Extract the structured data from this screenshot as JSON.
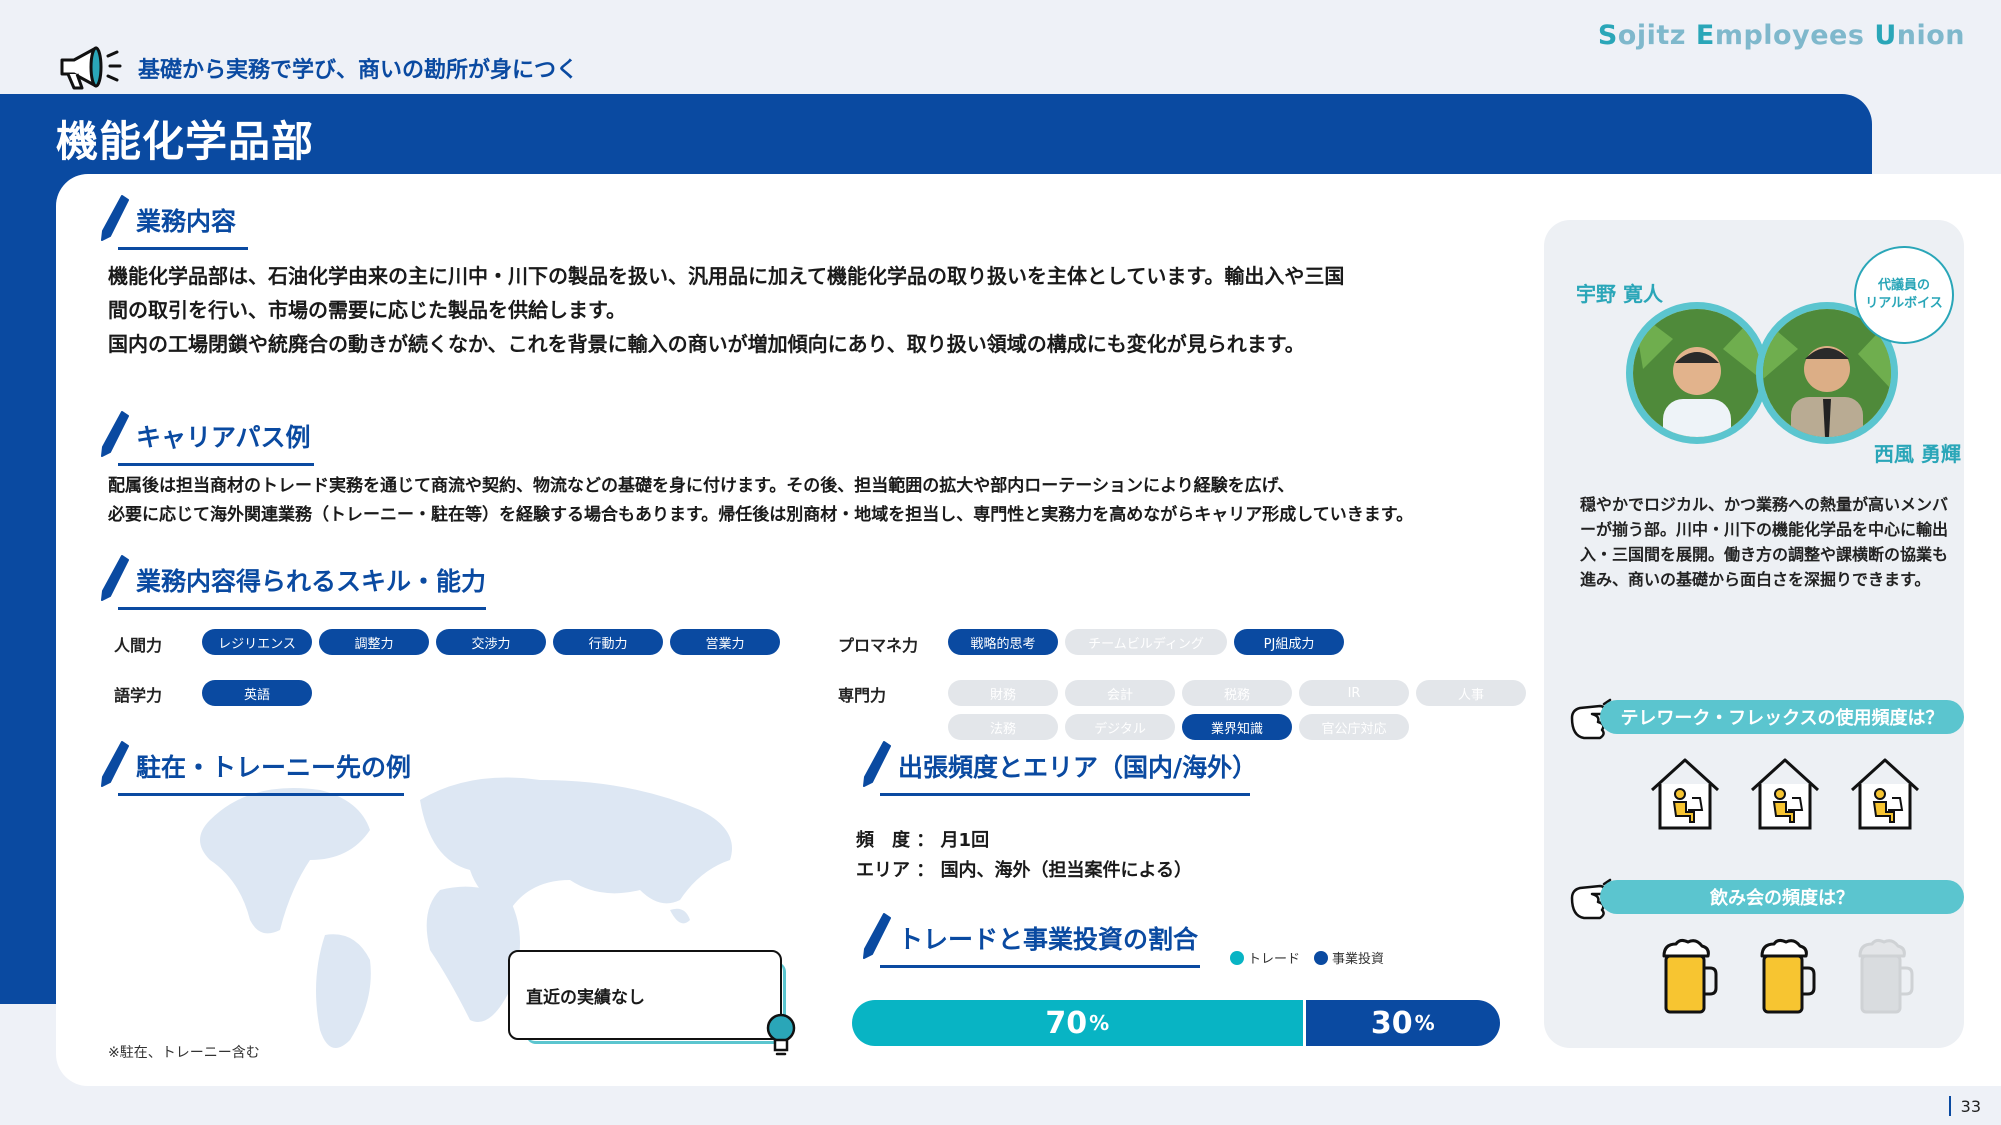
{
  "brand": {
    "s": "S",
    "ojitz": "ojitz ",
    "e": "E",
    "mployees": "mployees ",
    "u": "U",
    "nion": "nion"
  },
  "tagline": "基礎から実務で学び、商いの勘所が身につく",
  "department": "機能化学品部",
  "sections": {
    "business": {
      "title": "業務内容",
      "lines": [
        "機能化学品部は、石油化学由来の主に川中・川下の製品を扱い、汎用品に加えて機能化学品の取り扱いを主体としています。輸出入や三国",
        "間の取引を行い、市場の需要に応じた製品を供給します。",
        "国内の工場閉鎖や統廃合の動きが続くなか、これを背景に輸入の商いが増加傾向にあり、取り扱い領域の構成にも変化が見られます。"
      ]
    },
    "career": {
      "title": "キャリアパス例",
      "lines": [
        "配属後は担当商材のトレード実務を通じて商流や契約、物流などの基礎を身に付けます。その後、担当範囲の拡大や部内ローテーションにより経験を広げ、",
        "必要に応じて海外関連業務（トレーニー・駐在等）を経験する場合もあります。帰任後は別商材・地域を担当し、専門性と実務力を高めながらキャリア形成していきます。"
      ]
    },
    "skills": {
      "title": "業務内容得られるスキル・能力",
      "rows": {
        "human": {
          "label": "人間力",
          "items": [
            {
              "text": "レジリエンス",
              "on": true
            },
            {
              "text": "調整力",
              "on": true
            },
            {
              "text": "交渉力",
              "on": true
            },
            {
              "text": "行動力",
              "on": true
            },
            {
              "text": "営業力",
              "on": true
            }
          ]
        },
        "language": {
          "label": "語学力",
          "items": [
            {
              "text": "英語",
              "on": true
            }
          ]
        },
        "pm": {
          "label": "プロマネ力",
          "items": [
            {
              "text": "戦略的思考",
              "on": true
            },
            {
              "text": "チームビルディング",
              "on": false
            },
            {
              "text": "PJ組成力",
              "on": true
            }
          ]
        },
        "expert": {
          "label": "専門力",
          "items": [
            {
              "text": "財務",
              "on": false
            },
            {
              "text": "会計",
              "on": false
            },
            {
              "text": "税務",
              "on": false
            },
            {
              "text": "IR",
              "on": false
            },
            {
              "text": "人事",
              "on": false
            },
            {
              "text": "法務",
              "on": false
            },
            {
              "text": "デジタル",
              "on": false
            },
            {
              "text": "業界知識",
              "on": true
            },
            {
              "text": "官公庁対応",
              "on": false
            }
          ]
        }
      }
    },
    "overseas": {
      "title": "駐在・トレーニー先の例",
      "note": "直近の実績なし",
      "footnote": "※駐在、トレーニー含む"
    },
    "travel": {
      "title": "出張頻度とエリア（国内/海外）",
      "freq_label": "頻　度 ：",
      "freq_value": "月1回",
      "area_label": "エリア ：",
      "area_value": "国内、海外（担当案件による）"
    },
    "ratio": {
      "title": "トレードと事業投資の割合",
      "legend_trade": "トレード",
      "legend_invest": "事業投資"
    }
  },
  "chart_data": {
    "type": "bar",
    "categories": [
      "トレード",
      "事業投資"
    ],
    "values": [
      70,
      30
    ],
    "labels": [
      "70",
      "30"
    ],
    "unit": "%",
    "colors": [
      "#08b4c4",
      "#0a4aa1"
    ]
  },
  "panel": {
    "person1": "宇野 寛人",
    "person2": "西風 勇輝",
    "bubble_line1": "代議員の",
    "bubble_line2": "リアルボイス",
    "desc": "穏やかでロジカル、かつ業務への熱量が高いメンバーが揃う部。川中・川下の機能化学品を中心に輸出入・三国間を展開。働き方の調整や課横断の協業も進み、商いの基礎から面白さを深掘りできます。",
    "q1": "テレワーク・フレックスの使用頻度は？",
    "q1_level": 3,
    "q1_max": 3,
    "q2": "飲み会の頻度は？",
    "q2_level": 2,
    "q2_max": 3
  },
  "page_number": "33",
  "colors": {
    "primary": "#0a4aa1",
    "teal": "#5bc5cf",
    "trade": "#08b4c4"
  }
}
